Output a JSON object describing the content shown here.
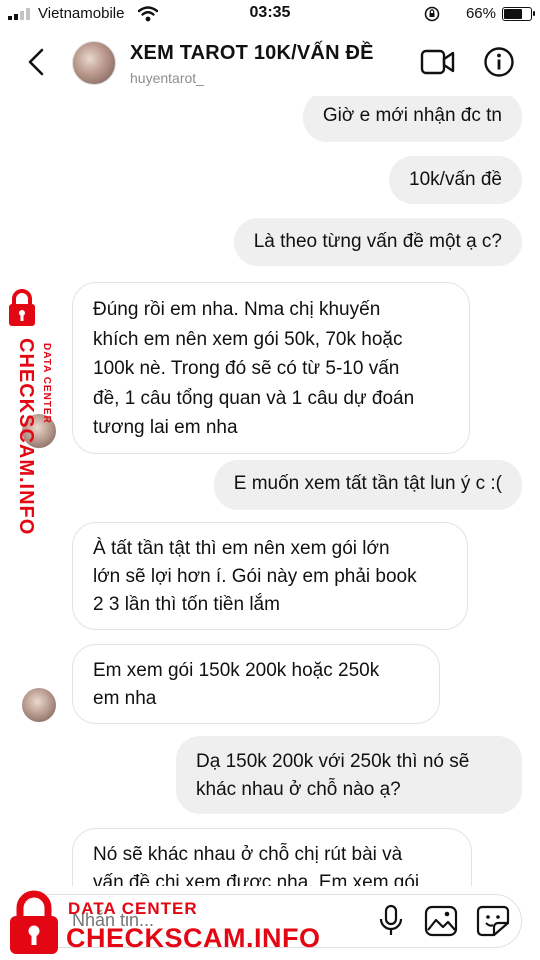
{
  "status_bar": {
    "carrier": "Vietnamobile",
    "time": "03:35",
    "battery": "66%",
    "icons": [
      "signal-icon",
      "wifi-icon",
      "orientation-lock-icon",
      "battery-icon"
    ]
  },
  "header": {
    "title": "XEM TAROT 10K/VẤN ĐỀ",
    "username": "huyentarot_",
    "icons": [
      "back-chevron-icon",
      "video-call-icon",
      "info-icon"
    ]
  },
  "messages": [
    {
      "from": "me",
      "text": "Giờ e mới nhận đc tn"
    },
    {
      "from": "me",
      "text": "10k/vấn đề"
    },
    {
      "from": "me",
      "text": "Là theo từng vấn đề một ạ c?"
    },
    {
      "from": "them",
      "lines": [
        "Đúng rồi em nha. Nma chị khuyến",
        "khích em nên xem gói 50k, 70k hoặc",
        "100k nè. Trong đó sẽ có từ 5-10 vấn",
        "đề, 1 câu tổng quan và 1 câu dự đoán",
        "tương lai em nha"
      ]
    },
    {
      "from": "me",
      "text": "E muốn xem tất tần tật lun ý c :("
    },
    {
      "from": "them",
      "lines": [
        "À tất tần tật thì em nên xem gói lớn",
        "lớn sẽ lợi hơn í. Gói này em phải book",
        "2 3 lần thì tốn tiền lắm"
      ]
    },
    {
      "from": "them",
      "lines": [
        "Em xem gói 150k 200k hoặc 250k",
        "em nha"
      ]
    },
    {
      "from": "me",
      "lines": [
        "Dạ 150k 200k với 250k thì nó sẽ",
        "khác nhau ở chỗ nào ạ?"
      ]
    },
    {
      "from": "them",
      "lines": [
        "Nó sẽ khác nhau ở chỗ chị rút bài và",
        "vấn đề chị xem được nha. Em xem gói"
      ]
    }
  ],
  "composer": {
    "placeholder": "Nhắn tin...",
    "icons": [
      "microphone-icon",
      "gallery-icon",
      "sticker-icon"
    ]
  },
  "watermark": {
    "side_big": "CHECKSCAM.INFO",
    "side_small": "DATA CENTER",
    "bottom_small": "DATA CENTER",
    "bottom_big": "CHECKSCAM.INFO",
    "color": "#e30613"
  }
}
